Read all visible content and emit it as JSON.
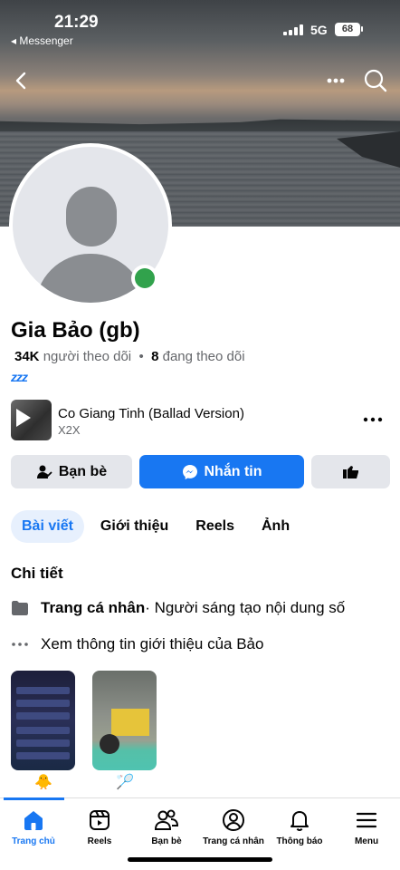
{
  "status_bar": {
    "time": "21:29",
    "back_app": "◂ Messenger",
    "network": "5G",
    "battery": "68"
  },
  "header": {
    "back_icon": "chevron-left-icon",
    "more_icon": "ellipsis-icon",
    "search_icon": "search-icon"
  },
  "profile": {
    "name": "Gia Bảo (gb)",
    "followers_count": "34K",
    "followers_label": "người theo dõi",
    "separator": "•",
    "following_count": "8",
    "following_label": "đang theo dõi",
    "status_emoji": "zzz"
  },
  "music": {
    "title": "Co Giang Tinh (Ballad Version)",
    "artist": "X2X"
  },
  "actions": {
    "friends_label": "Bạn bè",
    "message_label": "Nhắn tin",
    "like_icon": "thumbs-up-icon"
  },
  "tabs": [
    {
      "label": "Bài viết",
      "active": true
    },
    {
      "label": "Giới thiệu",
      "active": false
    },
    {
      "label": "Reels",
      "active": false
    },
    {
      "label": "Ảnh",
      "active": false
    }
  ],
  "details": {
    "title": "Chi tiết",
    "page_type_bold": "Trang cá nhân",
    "page_type_rest": " · Người sáng tạo nội dung số",
    "see_intro": "Xem thông tin giới thiệu của Bảo"
  },
  "featured": [
    {
      "emoji": "🐥"
    },
    {
      "emoji": "🏸"
    }
  ],
  "bottom_nav": [
    {
      "label": "Trang chủ",
      "icon": "home-icon",
      "active": true
    },
    {
      "label": "Reels",
      "icon": "reels-icon",
      "active": false
    },
    {
      "label": "Bạn bè",
      "icon": "friends-icon",
      "active": false
    },
    {
      "label": "Trang cá nhân",
      "icon": "profile-icon",
      "active": false
    },
    {
      "label": "Thông báo",
      "icon": "bell-icon",
      "active": false
    },
    {
      "label": "Menu",
      "icon": "menu-icon",
      "active": false
    }
  ],
  "colors": {
    "accent": "#1877f2",
    "online": "#31a24c",
    "secondary_button": "#e4e6eb"
  }
}
